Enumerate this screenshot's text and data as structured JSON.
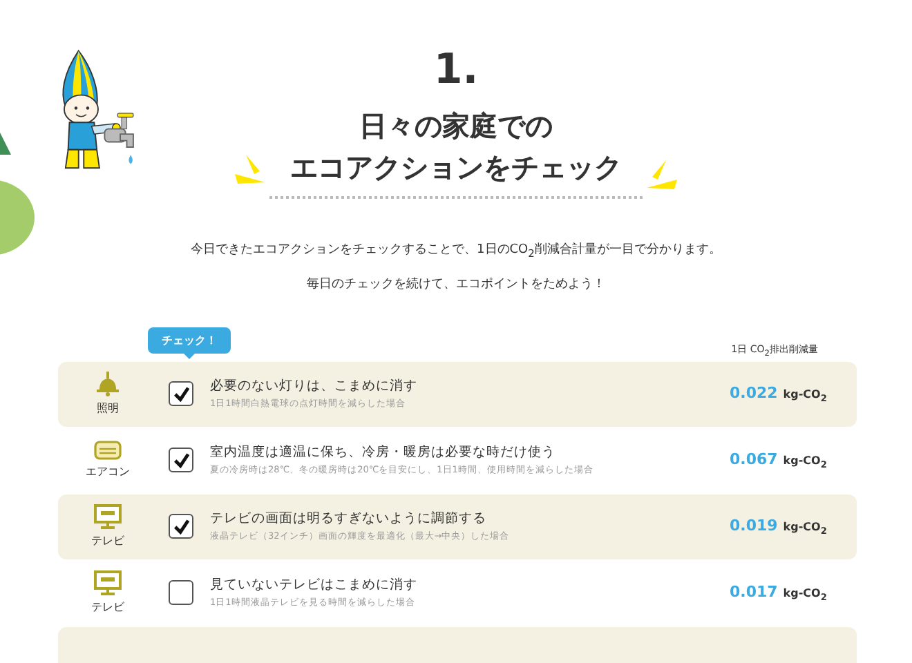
{
  "heading": {
    "number": "1.",
    "lines": [
      "日々の家庭での",
      "エコアクションをチェック"
    ]
  },
  "intro": [
    "今日できたエコアクションをチェックすることで、1日のCO$_{2}$削減合計量が一目で分かります。",
    "毎日のチェックを続けて、エコポイントをためよう！"
  ],
  "badge": "チェック！",
  "column_header": "1日 CO$_{2}$排出削減量",
  "rows": [
    {
      "kind": "lamp",
      "category": "照明",
      "checked": true,
      "title": "必要のない灯りは、こまめに消す",
      "note": "1日1時間白熱電球の点灯時間を減らした場合",
      "value": "0.022",
      "unit": "kg-CO$_{2}$"
    },
    {
      "kind": "aircon",
      "category": "エアコン",
      "checked": true,
      "title": "室内温度は適温に保ち、冷房・暖房は必要な時だけ使う",
      "note": "夏の冷房時は28℃、冬の暖房時は20℃を目安にし、1日1時間、使用時間を減らした場合",
      "value": "0.067",
      "unit": "kg-CO$_{2}$"
    },
    {
      "kind": "tv",
      "category": "テレビ",
      "checked": true,
      "title": "テレビの画面は明るすぎないように調節する",
      "note": "液晶テレビ（32インチ）画面の輝度を最適化（最大→中央）した場合",
      "value": "0.019",
      "unit": "kg-CO$_{2}$"
    },
    {
      "kind": "tv",
      "category": "テレビ",
      "checked": false,
      "title": "見ていないテレビはこまめに消す",
      "note": "1日1時間液晶テレビを見る時間を減らした場合",
      "value": "0.017",
      "unit": "kg-CO$_{2}$"
    }
  ],
  "more_rows_below": true
}
